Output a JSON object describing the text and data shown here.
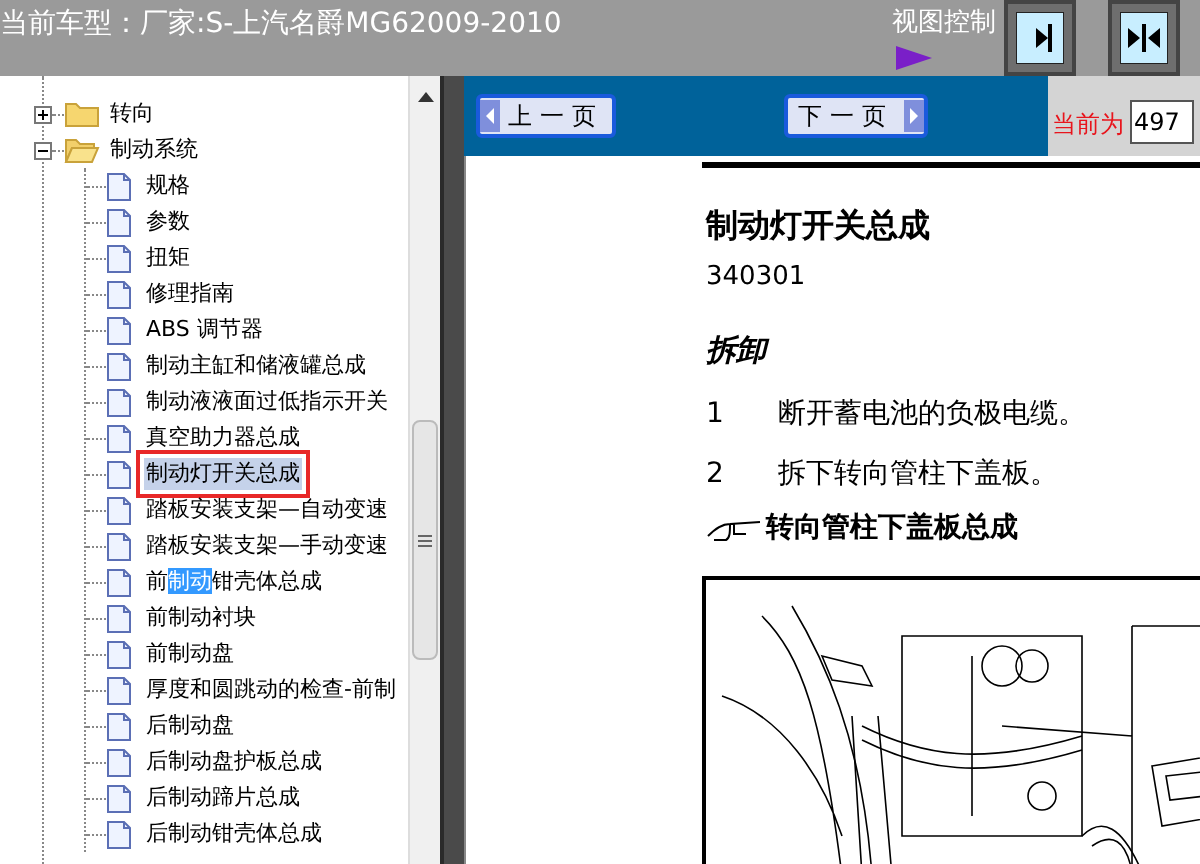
{
  "header": {
    "title": "当前车型：厂家:S-上汽名爵MG62009-2010",
    "view_control_label": "视图控制"
  },
  "tree": {
    "items": [
      {
        "label": "转向",
        "expanded": false
      },
      {
        "label": "制动系统",
        "expanded": true,
        "children": [
          {
            "segments": [
              {
                "text": "规格",
                "highlighted": false
              }
            ],
            "selected": false
          },
          {
            "segments": [
              {
                "text": "参数",
                "highlighted": false
              }
            ],
            "selected": false
          },
          {
            "segments": [
              {
                "text": "扭矩",
                "highlighted": false
              }
            ],
            "selected": false
          },
          {
            "segments": [
              {
                "text": "修理指南",
                "highlighted": false
              }
            ],
            "selected": false
          },
          {
            "segments": [
              {
                "text": "ABS 调节器",
                "highlighted": false
              }
            ],
            "selected": false
          },
          {
            "segments": [
              {
                "text": "制动主缸和储液罐总成",
                "highlighted": false
              }
            ],
            "selected": false
          },
          {
            "segments": [
              {
                "text": "制动液液面过低指示开关",
                "highlighted": false
              }
            ],
            "selected": false
          },
          {
            "segments": [
              {
                "text": "真空助力器总成",
                "highlighted": false
              }
            ],
            "selected": false
          },
          {
            "segments": [
              {
                "text": "制动灯开关总成",
                "highlighted": false
              }
            ],
            "selected": true
          },
          {
            "segments": [
              {
                "text": "踏板安装支架—自动变速",
                "highlighted": false
              }
            ],
            "selected": false
          },
          {
            "segments": [
              {
                "text": "踏板安装支架—手动变速",
                "highlighted": false
              }
            ],
            "selected": false
          },
          {
            "segments": [
              {
                "text": "前",
                "highlighted": false
              },
              {
                "text": "制动",
                "highlighted": true
              },
              {
                "text": "钳壳体总成",
                "highlighted": false
              }
            ],
            "selected": false
          },
          {
            "segments": [
              {
                "text": "前制动衬块",
                "highlighted": false
              }
            ],
            "selected": false
          },
          {
            "segments": [
              {
                "text": "前制动盘",
                "highlighted": false
              }
            ],
            "selected": false
          },
          {
            "segments": [
              {
                "text": "厚度和圆跳动的检查-前制",
                "highlighted": false
              }
            ],
            "selected": false
          },
          {
            "segments": [
              {
                "text": "后制动盘",
                "highlighted": false
              }
            ],
            "selected": false
          },
          {
            "segments": [
              {
                "text": "后制动盘护板总成",
                "highlighted": false
              }
            ],
            "selected": false
          },
          {
            "segments": [
              {
                "text": "后制动蹄片总成",
                "highlighted": false
              }
            ],
            "selected": false
          },
          {
            "segments": [
              {
                "text": "后制动钳壳体总成",
                "highlighted": false
              }
            ],
            "selected": false
          }
        ]
      }
    ]
  },
  "toolbar": {
    "prev_button": "上一页",
    "next_button": "下一页",
    "current_label": "当前为",
    "current_value": "497"
  },
  "document": {
    "title": "制动灯开关总成",
    "code": "340301",
    "section": "拆卸",
    "steps": [
      {
        "number": "1",
        "text": "断开蓄电池的负极电缆。"
      },
      {
        "number": "2",
        "text": "拆下转向管柱下盖板。"
      }
    ],
    "reference": "转向管柱下盖板总成"
  }
}
